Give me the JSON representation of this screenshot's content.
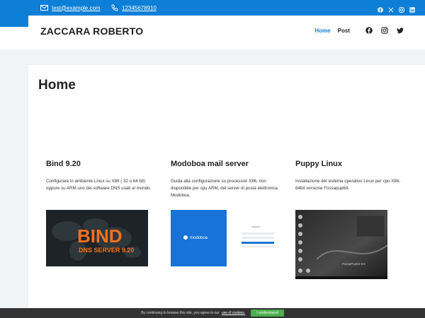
{
  "topbar": {
    "email": "test@example.com",
    "phone": "12345678910",
    "social_icons": [
      "facebook-icon",
      "x-icon",
      "instagram-icon",
      "linkedin-icon"
    ]
  },
  "header": {
    "site_title": "ZACCARA ROBERTO",
    "nav": [
      {
        "label": "Home",
        "active": true
      },
      {
        "label": "Post",
        "active": false
      }
    ],
    "nav_icons": [
      "facebook-icon",
      "instagram-icon",
      "twitter-icon"
    ]
  },
  "main": {
    "heading": "Home",
    "cards": [
      {
        "title": "Bind 9.20",
        "text": "Configurare in ambiente Linux su X86 ( 32 o 64 bit) oppure su ARM uno dei software DNS usati al mondo.",
        "image": {
          "title": "BIND",
          "subtitle": "DNS SERVER 9.20"
        }
      },
      {
        "title": "Modoboa mail server",
        "text": "Guida alla configurazione su processori X86, non disponibile per cpu ARM, del server di posta elettronica Modoboa.",
        "image": {
          "logo": "modoboa"
        }
      },
      {
        "title": "Puppy Linux",
        "text": "Installazione del sistema operativo Linux per cpu X86-64bit versione Fossapup64.",
        "image": {
          "desktop_label": "FossaPup64 9.5"
        }
      }
    ]
  },
  "cookie_bar": {
    "text": "By continuing to browse this site, you agree to our",
    "link": "use of cookies.",
    "button": "I understand"
  },
  "colors": {
    "accent": "#0d7fd6",
    "cookie_button": "#4caf50"
  }
}
